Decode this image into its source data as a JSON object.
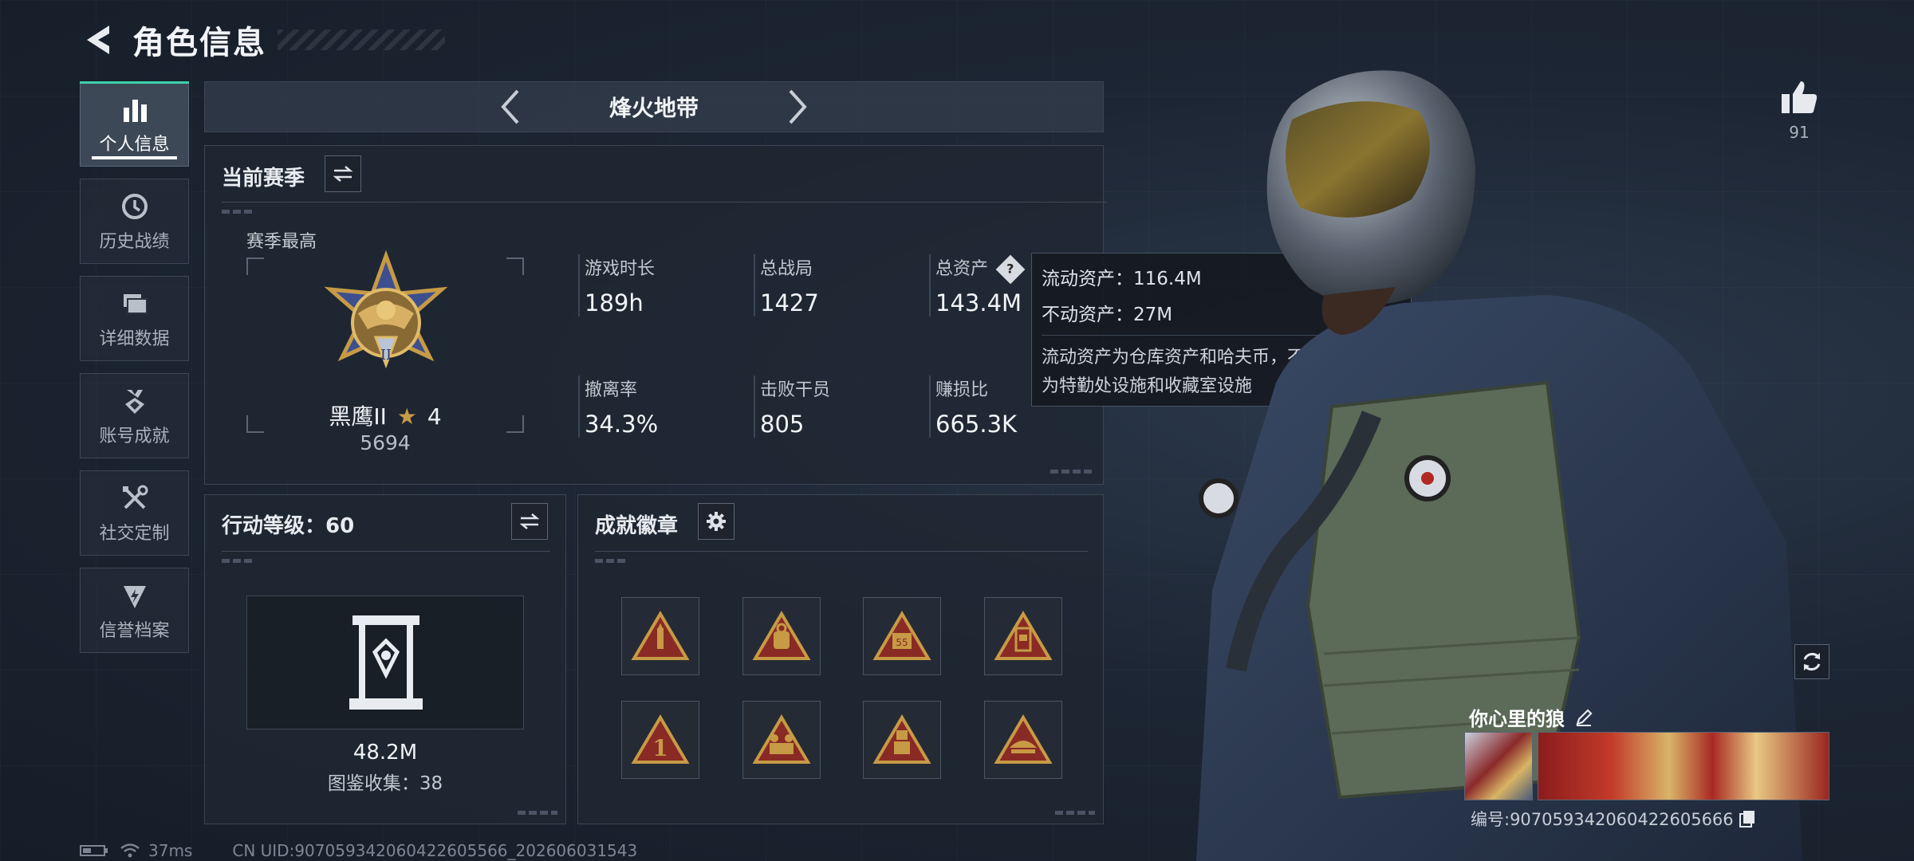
{
  "header": {
    "title": "角色信息"
  },
  "sidebar": {
    "items": [
      {
        "label": "个人信息",
        "icon": "bar-chart-icon",
        "active": true
      },
      {
        "label": "历史战绩",
        "icon": "history-clock-icon",
        "active": false
      },
      {
        "label": "详细数据",
        "icon": "folder-icon",
        "active": false
      },
      {
        "label": "账号成就",
        "icon": "achievement-medal-icon",
        "active": false
      },
      {
        "label": "社交定制",
        "icon": "wrench-screwdriver-icon",
        "active": false
      },
      {
        "label": "信誉档案",
        "icon": "shield-lightning-icon",
        "active": false
      }
    ]
  },
  "mode": {
    "title": "烽火地带"
  },
  "season": {
    "title": "当前赛季",
    "best_label": "赛季最高",
    "rank_name": "黑鹰II",
    "rank_stars": "4",
    "rank_score": "5694",
    "stats": [
      {
        "label": "游戏时长",
        "value": "189h"
      },
      {
        "label": "总战局",
        "value": "1427"
      },
      {
        "label": "总资产",
        "value": "143.4M"
      },
      {
        "label": "撤离率",
        "value": "34.3%"
      },
      {
        "label": "击败干员",
        "value": "805"
      },
      {
        "label": "赚损比",
        "value": "665.3K"
      }
    ]
  },
  "tooltip": {
    "liquid": "流动资产：116.4M",
    "fixed": "不动资产：27M",
    "desc_line1": "流动资产为仓库资产和哈夫币，不动资产",
    "desc_line2": "为特勤处设施和收藏室设施"
  },
  "action_level": {
    "title": "行动等级：60",
    "value": "48.2M",
    "collection": "图鉴收集：38"
  },
  "achievements": {
    "title": "成就徽章",
    "badges": [
      "rocket-badge-icon",
      "bag-badge-icon",
      "ammo-badge-icon",
      "cabinet-badge-icon",
      "number-one-badge-icon",
      "squad-badge-icon",
      "soldier-badge-icon",
      "ship-badge-icon"
    ]
  },
  "profile": {
    "likes": "91",
    "name": "你心里的狼",
    "id": "编号:907059342060422605666"
  },
  "status": {
    "ping": "37ms",
    "uid": "CN UID:907059342060422605566_202606031543"
  },
  "colors": {
    "accent": "#3fd0a8",
    "gold": "#c79a45",
    "badge_red": "#8a2a24"
  }
}
